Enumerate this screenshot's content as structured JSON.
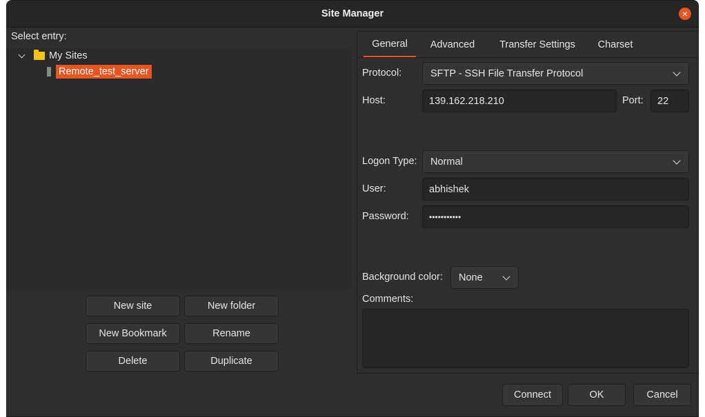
{
  "window": {
    "title": "Site Manager"
  },
  "tree": {
    "heading": "Select entry:",
    "folder": "My Sites",
    "site": "Remote_test_server"
  },
  "left_buttons": {
    "new_site": "New site",
    "new_folder": "New folder",
    "new_bookmark": "New Bookmark",
    "rename": "Rename",
    "delete": "Delete",
    "duplicate": "Duplicate"
  },
  "tabs": [
    "General",
    "Advanced",
    "Transfer Settings",
    "Charset"
  ],
  "general": {
    "protocol_label": "Protocol:",
    "protocol_value": "SFTP - SSH File Transfer Protocol",
    "host_label": "Host:",
    "host_value": "139.162.218.210",
    "port_label": "Port:",
    "port_value": "22",
    "logon_type_label": "Logon Type:",
    "logon_type_value": "Normal",
    "user_label": "User:",
    "user_value": "abhishek",
    "password_label": "Password:",
    "password_value": "•••••••••••",
    "bg_color_label": "Background color:",
    "bg_color_value": "None",
    "comments_label": "Comments:",
    "comments_value": ""
  },
  "footer": {
    "connect": "Connect",
    "ok": "OK",
    "cancel": "Cancel"
  },
  "colors": {
    "accent": "#e95420",
    "folder": "#f5c211"
  }
}
